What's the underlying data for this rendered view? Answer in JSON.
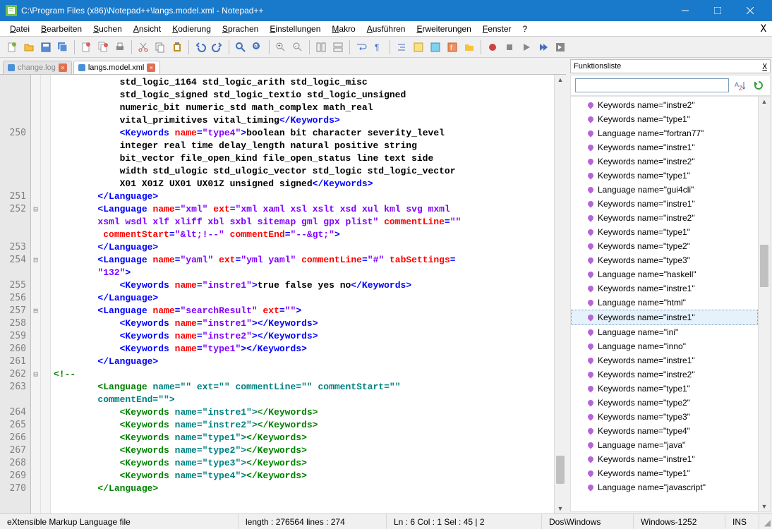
{
  "window": {
    "title": "C:\\Program Files (x86)\\Notepad++\\langs.model.xml - Notepad++"
  },
  "menu": {
    "items": [
      "Datei",
      "Bearbeiten",
      "Suchen",
      "Ansicht",
      "Kodierung",
      "Sprachen",
      "Einstellungen",
      "Makro",
      "Ausführen",
      "Erweiterungen",
      "Fenster",
      "?"
    ],
    "hotkeys": [
      "D",
      "B",
      "S",
      "A",
      "K",
      "S",
      "E",
      "M",
      "A",
      "E",
      "F",
      ""
    ]
  },
  "tabs": [
    {
      "label": "change.log",
      "active": false
    },
    {
      "label": "langs.model.xml",
      "active": true
    }
  ],
  "gutter_lines": [
    "",
    "",
    "",
    "",
    "250",
    "",
    "",
    "",
    "",
    "251",
    "252",
    "",
    "",
    "253",
    "254",
    "",
    "255",
    "256",
    "257",
    "258",
    "259",
    "260",
    "261",
    "262",
    "263",
    "",
    "264",
    "265",
    "266",
    "267",
    "268",
    "269",
    "270"
  ],
  "fold_marks": {
    "1": "",
    "9": "",
    "10": "⊟",
    "13": "",
    "14": "⊟",
    "17": "",
    "18": "⊟",
    "22": "",
    "23": "⊟",
    "32": ""
  },
  "code_lines": [
    {
      "t": "text",
      "v": "            std_logic_1164 std_logic_arith std_logic_misc "
    },
    {
      "t": "text",
      "v": "            std_logic_signed std_logic_textio std_logic_unsigned "
    },
    {
      "t": "text",
      "v": "            numeric_bit numeric_std math_complex math_real "
    },
    {
      "t": "mixed",
      "parts": [
        {
          "c": "text",
          "v": "            vital_primitives vital_timing"
        },
        {
          "c": "tag",
          "v": "</Keywords>"
        }
      ]
    },
    {
      "t": "mixed",
      "parts": [
        {
          "c": "text",
          "v": "            "
        },
        {
          "c": "tag",
          "v": "<Keywords "
        },
        {
          "c": "attr",
          "v": "name"
        },
        {
          "c": "tag",
          "v": "="
        },
        {
          "c": "str",
          "v": "\"type4\""
        },
        {
          "c": "tag",
          "v": ">"
        },
        {
          "c": "text",
          "v": "boolean bit character severity_level "
        }
      ]
    },
    {
      "t": "text",
      "v": "            integer real time delay_length natural positive string "
    },
    {
      "t": "text",
      "v": "            bit_vector file_open_kind file_open_status line text side "
    },
    {
      "t": "text",
      "v": "            width std_ulogic std_ulogic_vector std_logic std_logic_vector "
    },
    {
      "t": "mixed",
      "parts": [
        {
          "c": "text",
          "v": "            X01 X01Z UX01 UX01Z unsigned signed"
        },
        {
          "c": "tag",
          "v": "</Keywords>"
        }
      ]
    },
    {
      "t": "tag",
      "v": "        </Language>"
    },
    {
      "t": "mixed",
      "parts": [
        {
          "c": "text",
          "v": "        "
        },
        {
          "c": "tag",
          "v": "<Language "
        },
        {
          "c": "attr",
          "v": "name"
        },
        {
          "c": "tag",
          "v": "="
        },
        {
          "c": "str",
          "v": "\"xml\""
        },
        {
          "c": "attr",
          "v": " ext"
        },
        {
          "c": "tag",
          "v": "="
        },
        {
          "c": "str",
          "v": "\"xml xaml xsl xslt xsd xul kml svg mxml "
        }
      ]
    },
    {
      "t": "mixed",
      "parts": [
        {
          "c": "str",
          "v": "        xsml wsdl xlf xliff xbl sxbl sitemap gml gpx plist\""
        },
        {
          "c": "attr",
          "v": " commentLine"
        },
        {
          "c": "tag",
          "v": "="
        },
        {
          "c": "str",
          "v": "\"\""
        }
      ]
    },
    {
      "t": "mixed",
      "parts": [
        {
          "c": "attr",
          "v": "         commentStart"
        },
        {
          "c": "tag",
          "v": "="
        },
        {
          "c": "str",
          "v": "\"&lt;!--\""
        },
        {
          "c": "attr",
          "v": " commentEnd"
        },
        {
          "c": "tag",
          "v": "="
        },
        {
          "c": "str",
          "v": "\"--&gt;\""
        },
        {
          "c": "tag",
          "v": ">"
        }
      ]
    },
    {
      "t": "tag",
      "v": "        </Language>"
    },
    {
      "t": "mixed",
      "parts": [
        {
          "c": "text",
          "v": "        "
        },
        {
          "c": "tag",
          "v": "<Language "
        },
        {
          "c": "attr",
          "v": "name"
        },
        {
          "c": "tag",
          "v": "="
        },
        {
          "c": "str",
          "v": "\"yaml\""
        },
        {
          "c": "attr",
          "v": " ext"
        },
        {
          "c": "tag",
          "v": "="
        },
        {
          "c": "str",
          "v": "\"yml yaml\""
        },
        {
          "c": "attr",
          "v": " commentLine"
        },
        {
          "c": "tag",
          "v": "="
        },
        {
          "c": "str",
          "v": "\"#\""
        },
        {
          "c": "attr",
          "v": " tabSettings"
        },
        {
          "c": "tag",
          "v": "="
        }
      ]
    },
    {
      "t": "mixed",
      "parts": [
        {
          "c": "str",
          "v": "        \"132\""
        },
        {
          "c": "tag",
          "v": ">"
        }
      ]
    },
    {
      "t": "mixed",
      "parts": [
        {
          "c": "text",
          "v": "            "
        },
        {
          "c": "tag",
          "v": "<Keywords "
        },
        {
          "c": "attr",
          "v": "name"
        },
        {
          "c": "tag",
          "v": "="
        },
        {
          "c": "str",
          "v": "\"instre1\""
        },
        {
          "c": "tag",
          "v": ">"
        },
        {
          "c": "text",
          "v": "true false yes no"
        },
        {
          "c": "tag",
          "v": "</Keywords>"
        }
      ]
    },
    {
      "t": "tag",
      "v": "        </Language>"
    },
    {
      "t": "mixed",
      "parts": [
        {
          "c": "text",
          "v": "        "
        },
        {
          "c": "tag",
          "v": "<Language "
        },
        {
          "c": "attr",
          "v": "name"
        },
        {
          "c": "tag",
          "v": "="
        },
        {
          "c": "str",
          "v": "\"searchResult\""
        },
        {
          "c": "attr",
          "v": " ext"
        },
        {
          "c": "tag",
          "v": "="
        },
        {
          "c": "str",
          "v": "\"\""
        },
        {
          "c": "tag",
          "v": ">"
        }
      ]
    },
    {
      "t": "mixed",
      "parts": [
        {
          "c": "text",
          "v": "            "
        },
        {
          "c": "tag",
          "v": "<Keywords "
        },
        {
          "c": "attr",
          "v": "name"
        },
        {
          "c": "tag",
          "v": "="
        },
        {
          "c": "str",
          "v": "\"instre1\""
        },
        {
          "c": "tag",
          "v": "></Keywords>"
        }
      ]
    },
    {
      "t": "mixed",
      "parts": [
        {
          "c": "text",
          "v": "            "
        },
        {
          "c": "tag",
          "v": "<Keywords "
        },
        {
          "c": "attr",
          "v": "name"
        },
        {
          "c": "tag",
          "v": "="
        },
        {
          "c": "str",
          "v": "\"instre2\""
        },
        {
          "c": "tag",
          "v": "></Keywords>"
        }
      ]
    },
    {
      "t": "mixed",
      "parts": [
        {
          "c": "text",
          "v": "            "
        },
        {
          "c": "tag",
          "v": "<Keywords "
        },
        {
          "c": "attr",
          "v": "name"
        },
        {
          "c": "tag",
          "v": "="
        },
        {
          "c": "str",
          "v": "\"type1\""
        },
        {
          "c": "tag",
          "v": "></Keywords>"
        }
      ]
    },
    {
      "t": "tag",
      "v": "        </Language>"
    },
    {
      "t": "cmt",
      "v": "<!--"
    },
    {
      "t": "mixed",
      "parts": [
        {
          "c": "cmt",
          "v": "        <Language "
        },
        {
          "c": "cmtattr",
          "v": "name=\"\" ext=\"\" commentLine=\"\" commentStart=\"\" "
        }
      ]
    },
    {
      "t": "cmtattr",
      "v": "        commentEnd=\"\">"
    },
    {
      "t": "mixed",
      "parts": [
        {
          "c": "cmt",
          "v": "            <Keywords "
        },
        {
          "c": "cmtattr",
          "v": "name=\"instre1\">"
        },
        {
          "c": "cmt",
          "v": "</Keywords>"
        }
      ]
    },
    {
      "t": "mixed",
      "parts": [
        {
          "c": "cmt",
          "v": "            <Keywords "
        },
        {
          "c": "cmtattr",
          "v": "name=\"instre2\">"
        },
        {
          "c": "cmt",
          "v": "</Keywords>"
        }
      ]
    },
    {
      "t": "mixed",
      "parts": [
        {
          "c": "cmt",
          "v": "            <Keywords "
        },
        {
          "c": "cmtattr",
          "v": "name=\"type1\">"
        },
        {
          "c": "cmt",
          "v": "</Keywords>"
        }
      ]
    },
    {
      "t": "mixed",
      "parts": [
        {
          "c": "cmt",
          "v": "            <Keywords "
        },
        {
          "c": "cmtattr",
          "v": "name=\"type2\">"
        },
        {
          "c": "cmt",
          "v": "</Keywords>"
        }
      ]
    },
    {
      "t": "mixed",
      "parts": [
        {
          "c": "cmt",
          "v": "            <Keywords "
        },
        {
          "c": "cmtattr",
          "v": "name=\"type3\">"
        },
        {
          "c": "cmt",
          "v": "</Keywords>"
        }
      ]
    },
    {
      "t": "mixed",
      "parts": [
        {
          "c": "cmt",
          "v": "            <Keywords "
        },
        {
          "c": "cmtattr",
          "v": "name=\"type4\">"
        },
        {
          "c": "cmt",
          "v": "</Keywords>"
        }
      ]
    },
    {
      "t": "cmt",
      "v": "        </Language>"
    }
  ],
  "side": {
    "title": "Funktionsliste",
    "search_placeholder": "",
    "items": [
      {
        "label": "Keywords name=\"instre2\""
      },
      {
        "label": "Keywords name=\"type1\""
      },
      {
        "label": "Language name=\"fortran77\""
      },
      {
        "label": "Keywords name=\"instre1\""
      },
      {
        "label": "Keywords name=\"instre2\""
      },
      {
        "label": "Keywords name=\"type1\""
      },
      {
        "label": "Language name=\"gui4cli\""
      },
      {
        "label": "Keywords name=\"instre1\""
      },
      {
        "label": "Keywords name=\"instre2\""
      },
      {
        "label": "Keywords name=\"type1\""
      },
      {
        "label": "Keywords name=\"type2\""
      },
      {
        "label": "Keywords name=\"type3\""
      },
      {
        "label": "Language name=\"haskell\""
      },
      {
        "label": "Keywords name=\"instre1\""
      },
      {
        "label": "Language name=\"html\""
      },
      {
        "label": "Keywords name=\"instre1\"",
        "sel": true
      },
      {
        "label": "Language name=\"ini\""
      },
      {
        "label": "Language name=\"inno\""
      },
      {
        "label": "Keywords name=\"instre1\""
      },
      {
        "label": "Keywords name=\"instre2\""
      },
      {
        "label": "Keywords name=\"type1\""
      },
      {
        "label": "Keywords name=\"type2\""
      },
      {
        "label": "Keywords name=\"type3\""
      },
      {
        "label": "Keywords name=\"type4\""
      },
      {
        "label": "Language name=\"java\""
      },
      {
        "label": "Keywords name=\"instre1\""
      },
      {
        "label": "Keywords name=\"type1\""
      },
      {
        "label": "Language name=\"javascript\""
      }
    ]
  },
  "status": {
    "filetype": "eXtensible Markup Language file",
    "length": "length : 276564    lines : 274",
    "pos": "Ln : 6    Col : 1    Sel : 45 | 2",
    "eol": "Dos\\Windows",
    "encoding": "Windows-1252",
    "mode": "INS"
  }
}
